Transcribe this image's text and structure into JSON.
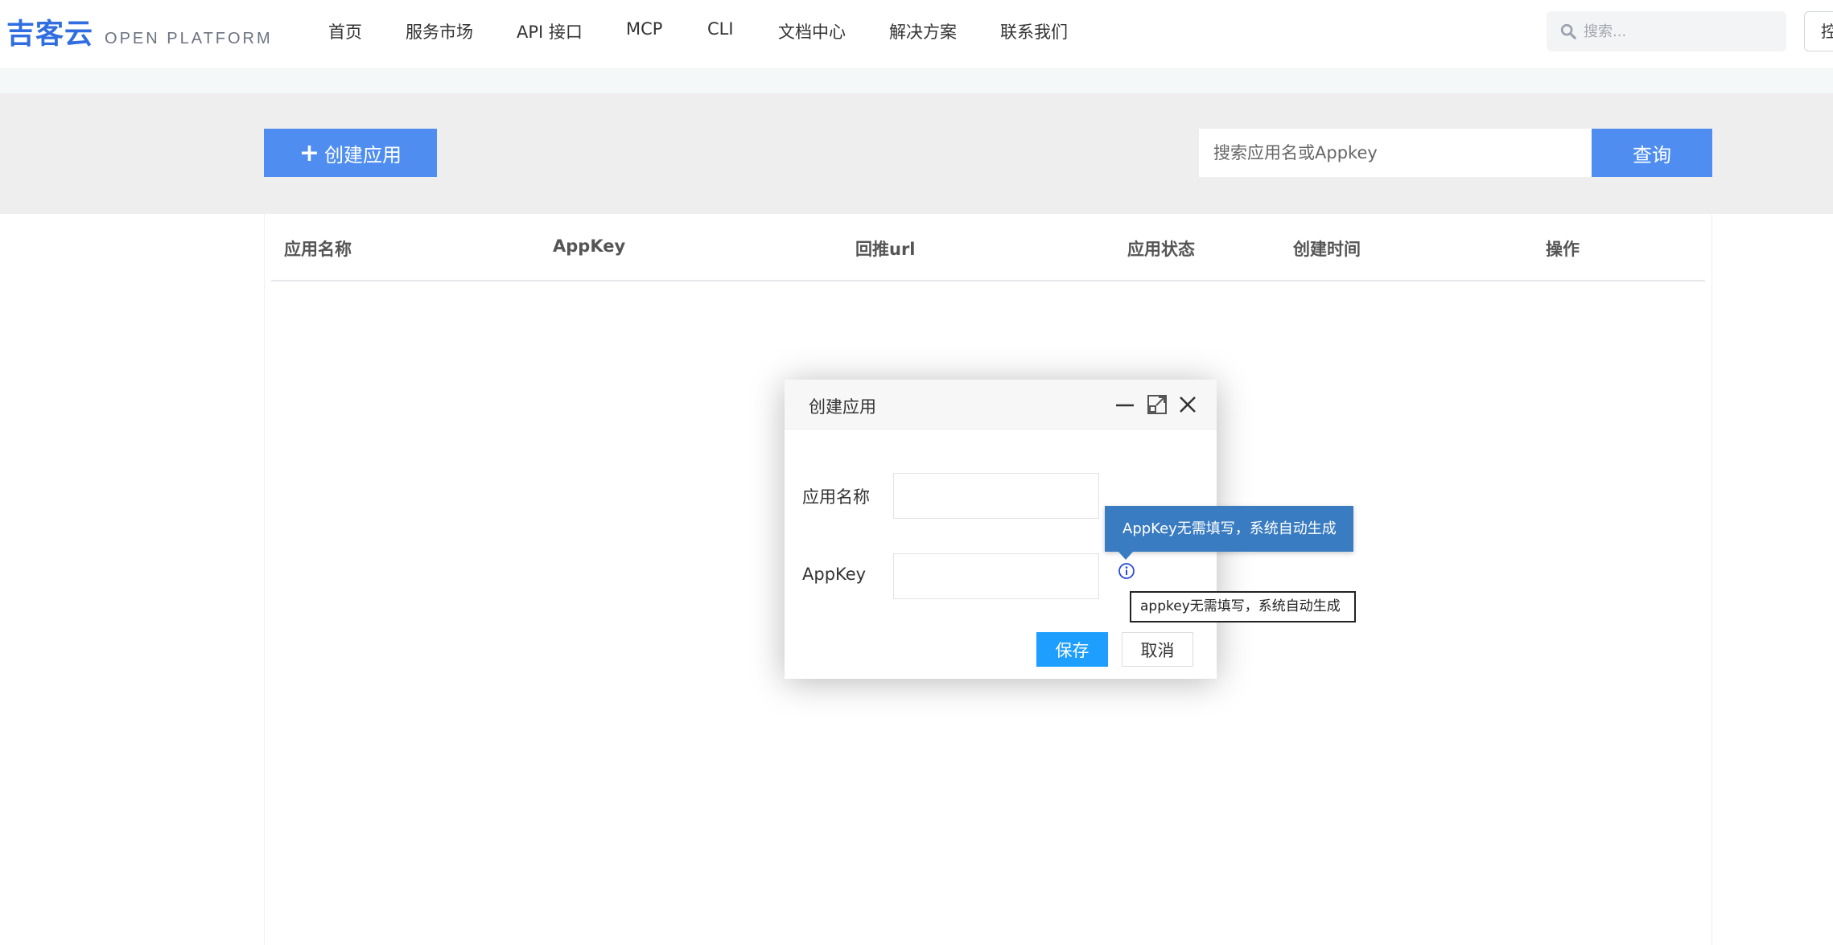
{
  "header": {
    "logo_cn": "吉客云",
    "logo_en": "OPEN PLATFORM",
    "nav": [
      {
        "label": "首页"
      },
      {
        "label": "服务市场"
      },
      {
        "label": "API 接口"
      },
      {
        "label": "MCP"
      },
      {
        "label": "CLI"
      },
      {
        "label": "文档中心"
      },
      {
        "label": "解决方案"
      },
      {
        "label": "联系我们"
      }
    ],
    "search_placeholder": "搜索...",
    "login_label": "控制台"
  },
  "toolbar": {
    "create_label": "创建应用",
    "query_placeholder": "搜索应用名或Appkey",
    "query_label": "查询"
  },
  "table": {
    "columns": [
      "应用名称",
      "AppKey",
      "回推url",
      "应用状态",
      "创建时间",
      "操作"
    ]
  },
  "modal": {
    "title": "创建应用",
    "fields": [
      {
        "label": "应用名称",
        "value": ""
      },
      {
        "label": "AppKey",
        "value": ""
      }
    ],
    "save_label": "保存",
    "cancel_label": "取消"
  },
  "tooltips": {
    "popover": "AppKey无需填写，系统自动生成",
    "native": "appkey无需填写，系统自动生成"
  },
  "colors": {
    "brand": "#2f6de0",
    "primary_button": "#4f8ef0",
    "save_button": "#1e9fff",
    "tooltip_bg": "#3a7cc1"
  }
}
